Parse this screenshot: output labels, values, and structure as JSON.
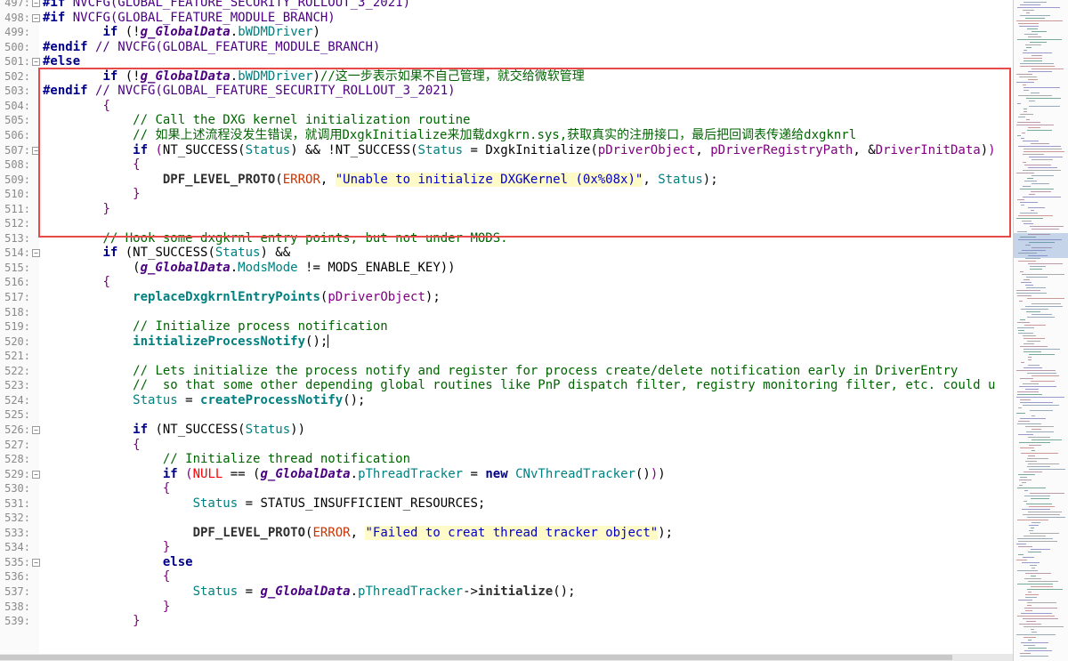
{
  "editor": {
    "lines": [
      {
        "num": "497",
        "fold": true,
        "segs": [
          [
            "pp",
            "#if"
          ],
          [
            "ppm",
            " NVCFG(GLOBAL_FEATURE_SECURITY_ROLLOUT_3_2021)"
          ]
        ]
      },
      {
        "num": "498",
        "fold": true,
        "segs": [
          [
            "pp",
            "#if"
          ],
          [
            "ppm",
            " NVCFG(GLOBAL_FEATURE_MODULE_BRANCH)"
          ]
        ]
      },
      {
        "num": "499",
        "fold": false,
        "segs": [
          [
            "",
            "        "
          ],
          [
            "kw",
            "if"
          ],
          [
            "",
            " (!"
          ],
          [
            "gl",
            "g_GlobalData"
          ],
          [
            "",
            "."
          ],
          [
            "mem",
            "bWDMDriver"
          ],
          [
            "",
            ")"
          ]
        ]
      },
      {
        "num": "500",
        "fold": false,
        "segs": [
          [
            "pp",
            "#endif"
          ],
          [
            "ppm",
            " // NVCFG(GLOBAL_FEATURE_MODULE_BRANCH)"
          ]
        ]
      },
      {
        "num": "501",
        "fold": true,
        "segs": [
          [
            "pp",
            "#else"
          ]
        ]
      },
      {
        "num": "502",
        "fold": false,
        "segs": [
          [
            "",
            "        "
          ],
          [
            "kw",
            "if"
          ],
          [
            "",
            " (!"
          ],
          [
            "gl",
            "g_GlobalData"
          ],
          [
            "",
            "."
          ],
          [
            "mem",
            "bWDMDriver"
          ],
          [
            "",
            ")"
          ],
          [
            "cmt",
            "//这一步表示如果不自己管理，就交给微软管理"
          ]
        ]
      },
      {
        "num": "503",
        "fold": false,
        "segs": [
          [
            "pp",
            "#endif"
          ],
          [
            "ppm",
            " // NVCFG(GLOBAL_FEATURE_SECURITY_ROLLOUT_3_2021)"
          ]
        ]
      },
      {
        "num": "504",
        "fold": false,
        "segs": [
          [
            "",
            "        "
          ],
          [
            "brace",
            "{"
          ]
        ]
      },
      {
        "num": "505",
        "fold": false,
        "segs": [
          [
            "",
            "            "
          ],
          [
            "cmt",
            "// Call the DXG kernel initialization routine"
          ]
        ]
      },
      {
        "num": "506",
        "fold": false,
        "segs": [
          [
            "",
            "            "
          ],
          [
            "cmt",
            "// 如果上述流程没发生错误，就调用DxgkInitialize来加载dxgkrn.sys,获取真实的注册接口，最后把回调表传递给dxgknrl"
          ]
        ]
      },
      {
        "num": "507",
        "fold": true,
        "segs": [
          [
            "",
            "            "
          ],
          [
            "kw",
            "if"
          ],
          [
            "",
            " "
          ],
          [
            "par",
            "("
          ],
          [
            "",
            "NT_SUCCESS("
          ],
          [
            "mem",
            "Status"
          ],
          [
            "",
            ") && !NT_SUCCESS("
          ],
          [
            "mem",
            "Status"
          ],
          [
            "",
            " = DxgkInitialize("
          ],
          [
            "par",
            "pDriverObject"
          ],
          [
            "",
            ", "
          ],
          [
            "par",
            "pDriverRegistryPath"
          ],
          [
            "",
            ", &"
          ],
          [
            "par",
            "DriverInitData"
          ],
          [
            "",
            ")"
          ],
          [
            "par",
            ")"
          ]
        ]
      },
      {
        "num": "508",
        "fold": false,
        "segs": [
          [
            "",
            "            "
          ],
          [
            "brace",
            "{"
          ]
        ]
      },
      {
        "num": "509",
        "fold": false,
        "segs": [
          [
            "",
            "                "
          ],
          [
            "fn",
            "DPF_LEVEL_PROTO"
          ],
          [
            "",
            "("
          ],
          [
            "err",
            "ERROR"
          ],
          [
            "",
            ", "
          ],
          [
            "str",
            "\"Unable to initialize DXGKernel (0x%08x)\""
          ],
          [
            "",
            ", "
          ],
          [
            "mem",
            "Status"
          ],
          [
            "",
            ");"
          ]
        ]
      },
      {
        "num": "510",
        "fold": false,
        "segs": [
          [
            "",
            "            "
          ],
          [
            "brace",
            "}"
          ]
        ]
      },
      {
        "num": "511",
        "fold": false,
        "segs": [
          [
            "",
            "        "
          ],
          [
            "brace",
            "}"
          ]
        ]
      },
      {
        "num": "512",
        "fold": false,
        "segs": []
      },
      {
        "num": "513",
        "fold": false,
        "segs": [
          [
            "",
            "        "
          ],
          [
            "cmt",
            "// Hook some dxgkrnl entry points, but not under MODS."
          ]
        ]
      },
      {
        "num": "514",
        "fold": true,
        "segs": [
          [
            "",
            "        "
          ],
          [
            "kw",
            "if"
          ],
          [
            "",
            " (NT_SUCCESS("
          ],
          [
            "mem",
            "Status"
          ],
          [
            "",
            ") &&"
          ]
        ]
      },
      {
        "num": "515",
        "fold": false,
        "segs": [
          [
            "",
            "            ("
          ],
          [
            "gl",
            "g_GlobalData"
          ],
          [
            "",
            "."
          ],
          [
            "mem",
            "ModsMode"
          ],
          [
            "",
            " != MODS_ENABLE_KEY))"
          ]
        ]
      },
      {
        "num": "516",
        "fold": false,
        "segs": [
          [
            "",
            "        "
          ],
          [
            "brace",
            "{"
          ]
        ]
      },
      {
        "num": "517",
        "fold": false,
        "segs": [
          [
            "",
            "            "
          ],
          [
            "fnc",
            "replaceDxgkrnlEntryPoints"
          ],
          [
            "",
            "("
          ],
          [
            "par",
            "pDriverObject"
          ],
          [
            "",
            ");"
          ]
        ]
      },
      {
        "num": "518",
        "fold": false,
        "segs": []
      },
      {
        "num": "519",
        "fold": false,
        "segs": [
          [
            "",
            "            "
          ],
          [
            "cmt",
            "// Initialize process notification"
          ]
        ]
      },
      {
        "num": "520",
        "fold": false,
        "segs": [
          [
            "",
            "            "
          ],
          [
            "fnc",
            "initializeProcessNotify"
          ],
          [
            "",
            "();"
          ]
        ],
        "caret": true
      },
      {
        "num": "521",
        "fold": false,
        "segs": []
      },
      {
        "num": "522",
        "fold": false,
        "segs": [
          [
            "",
            "            "
          ],
          [
            "cmt",
            "// Lets initialize the process notify and register for process create/delete notification early in DriverEntry"
          ]
        ]
      },
      {
        "num": "523",
        "fold": false,
        "segs": [
          [
            "",
            "            "
          ],
          [
            "cmt",
            "//  so that some other depending global routines like PnP dispatch filter, registry monitoring filter, etc. could u"
          ]
        ]
      },
      {
        "num": "524",
        "fold": false,
        "segs": [
          [
            "",
            "            "
          ],
          [
            "mem",
            "Status"
          ],
          [
            "",
            " = "
          ],
          [
            "fnc",
            "createProcessNotify"
          ],
          [
            "",
            "();"
          ]
        ]
      },
      {
        "num": "525",
        "fold": false,
        "segs": []
      },
      {
        "num": "526",
        "fold": true,
        "segs": [
          [
            "",
            "            "
          ],
          [
            "kw",
            "if"
          ],
          [
            "",
            " (NT_SUCCESS("
          ],
          [
            "mem",
            "Status"
          ],
          [
            "",
            "))"
          ]
        ]
      },
      {
        "num": "527",
        "fold": false,
        "segs": [
          [
            "",
            "            "
          ],
          [
            "brace",
            "{"
          ]
        ]
      },
      {
        "num": "528",
        "fold": false,
        "segs": [
          [
            "",
            "                "
          ],
          [
            "cmt",
            "// Initialize thread notification"
          ]
        ]
      },
      {
        "num": "529",
        "fold": true,
        "segs": [
          [
            "",
            "                "
          ],
          [
            "kw",
            "if"
          ],
          [
            "",
            " "
          ],
          [
            "par",
            "("
          ],
          [
            "nul",
            "NULL"
          ],
          [
            "",
            " == ("
          ],
          [
            "gl",
            "g_GlobalData"
          ],
          [
            "",
            "."
          ],
          [
            "mem",
            "pThreadTracker"
          ],
          [
            "",
            " = "
          ],
          [
            "kw",
            "new"
          ],
          [
            "",
            " "
          ],
          [
            "mem",
            "CNvThreadTracker"
          ],
          [
            "",
            "()"
          ],
          [
            "par",
            ")"
          ],
          [
            "",
            ")"
          ]
        ]
      },
      {
        "num": "530",
        "fold": false,
        "segs": [
          [
            "",
            "                "
          ],
          [
            "brace",
            "{"
          ]
        ]
      },
      {
        "num": "531",
        "fold": false,
        "segs": [
          [
            "",
            "                    "
          ],
          [
            "mem",
            "Status"
          ],
          [
            "",
            " = STATUS_INSUFFICIENT_RESOURCES;"
          ]
        ]
      },
      {
        "num": "532",
        "fold": false,
        "segs": []
      },
      {
        "num": "533",
        "fold": false,
        "segs": [
          [
            "",
            "                    "
          ],
          [
            "fn",
            "DPF_LEVEL_PROTO"
          ],
          [
            "",
            "("
          ],
          [
            "err",
            "ERROR"
          ],
          [
            "",
            ", "
          ],
          [
            "str",
            "\"Failed to creat thread tracker object\""
          ],
          [
            "",
            ");"
          ]
        ]
      },
      {
        "num": "534",
        "fold": false,
        "segs": [
          [
            "",
            "                "
          ],
          [
            "brace",
            "}"
          ]
        ]
      },
      {
        "num": "535",
        "fold": true,
        "segs": [
          [
            "",
            "                "
          ],
          [
            "kw",
            "else"
          ]
        ]
      },
      {
        "num": "536",
        "fold": false,
        "segs": [
          [
            "",
            "                "
          ],
          [
            "brace",
            "{"
          ]
        ]
      },
      {
        "num": "537",
        "fold": false,
        "segs": [
          [
            "",
            "                    "
          ],
          [
            "mem",
            "Status"
          ],
          [
            "",
            " = "
          ],
          [
            "gl",
            "g_GlobalData"
          ],
          [
            "",
            "."
          ],
          [
            "mem",
            "pThreadTracker"
          ],
          [
            "",
            "->"
          ],
          [
            "fn",
            "initialize"
          ],
          [
            "",
            "();"
          ]
        ]
      },
      {
        "num": "538",
        "fold": false,
        "segs": [
          [
            "",
            "                "
          ],
          [
            "brace",
            "}"
          ]
        ]
      },
      {
        "num": "539",
        "fold": false,
        "segs": [
          [
            "",
            "            "
          ],
          [
            "brace",
            "}"
          ]
        ]
      }
    ]
  },
  "colors": {
    "highlight_box": "#e84a4a",
    "string_background": "#fffbc8",
    "comment": "#006400",
    "keyword": "#00008b"
  }
}
